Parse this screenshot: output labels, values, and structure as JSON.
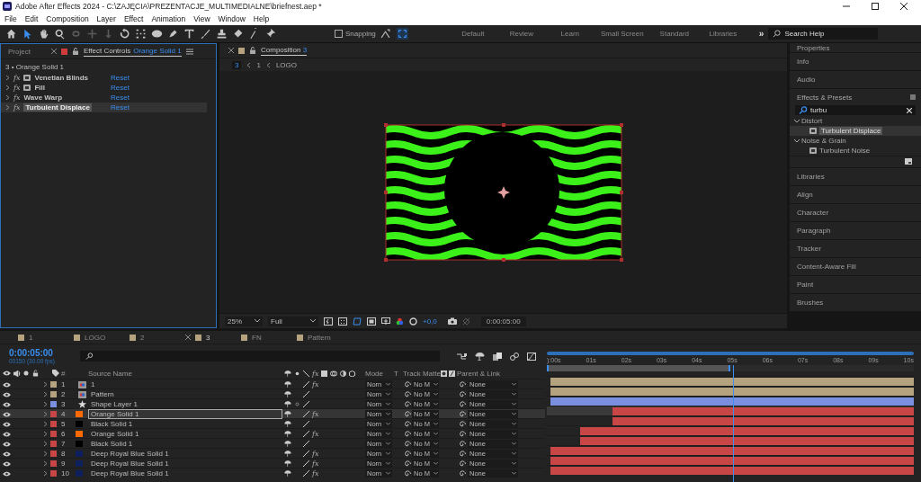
{
  "window": {
    "title": "Adobe After Effects 2024 - C:\\ZAJĘCIA\\PREZENTACJE_MULTIMEDIALNE\\briefnest.aep *"
  },
  "menu": [
    "File",
    "Edit",
    "Composition",
    "Layer",
    "Effect",
    "Animation",
    "View",
    "Window",
    "Help"
  ],
  "tools": [
    {
      "kind": "home",
      "selected": false,
      "disabled": false
    },
    {
      "kind": "select",
      "selected": true,
      "disabled": false
    },
    {
      "kind": "hand",
      "selected": false,
      "disabled": false
    },
    {
      "kind": "zoom",
      "selected": false,
      "disabled": false
    },
    {
      "kind": "orbit",
      "selected": false,
      "disabled": true
    },
    {
      "kind": "move",
      "selected": false,
      "disabled": true
    },
    {
      "kind": "dolly",
      "selected": false,
      "disabled": true
    },
    {
      "kind": "rotate",
      "selected": false,
      "disabled": false
    },
    {
      "kind": "anchor",
      "selected": false,
      "disabled": false
    },
    {
      "kind": "ellipse",
      "selected": false,
      "disabled": false
    },
    {
      "kind": "pen",
      "selected": false,
      "disabled": false
    },
    {
      "kind": "type",
      "selected": false,
      "disabled": false
    },
    {
      "kind": "brush",
      "selected": false,
      "disabled": false
    },
    {
      "kind": "stamp",
      "selected": false,
      "disabled": false
    },
    {
      "kind": "eraser",
      "selected": false,
      "disabled": false
    },
    {
      "kind": "roto",
      "selected": false,
      "disabled": false
    },
    {
      "kind": "pin",
      "selected": false,
      "disabled": false
    }
  ],
  "snapping": {
    "label": "Snapping",
    "checked": false
  },
  "workspaces": [
    "Default",
    "Review",
    "Learn",
    "Small Screen",
    "Standard",
    "Libraries"
  ],
  "more": "»",
  "search_help": {
    "placeholder": "Search Help"
  },
  "effect_controls": {
    "tabs": [
      {
        "label": "Project",
        "selected": false
      },
      {
        "label": "Effect Controls",
        "target": "Orange Solid 1",
        "color": "#d03c3c",
        "selected": true
      }
    ],
    "layer_title": "3 • Orange Solid 1",
    "effects": [
      {
        "fx": "fx",
        "name": "Venetian Blinds",
        "preset": true,
        "reset": "Reset",
        "selected": false
      },
      {
        "fx": "fx",
        "name": "Fill",
        "preset": true,
        "reset": "Reset",
        "selected": false
      },
      {
        "fx": "fx",
        "name": "Wave Warp",
        "preset": false,
        "reset": "Reset",
        "selected": false
      },
      {
        "fx": "fx",
        "name": "Turbulent Displace",
        "preset": false,
        "reset": "Reset",
        "selected": true
      }
    ]
  },
  "composition": {
    "tab": {
      "label": "Composition",
      "target": "3",
      "color": "#b5a27f"
    },
    "breadcrumb": [
      "3",
      "1",
      "LOGO"
    ],
    "zoom": "25%",
    "resolution": "Full",
    "exposure": "+0,0",
    "timecode": "0:00:05:00"
  },
  "panels_above": [
    "Properties",
    "Info",
    "Audio"
  ],
  "effects_presets": {
    "title": "Effects & Presets",
    "search": "turbu",
    "tree": [
      {
        "label": "Distort",
        "expanded": true,
        "children": [
          {
            "label": "Turbulent Displace",
            "selected": true
          }
        ]
      },
      {
        "label": "Noise & Grain",
        "expanded": true,
        "children": [
          {
            "label": "Turbulent Noise",
            "selected": false
          }
        ]
      }
    ]
  },
  "panels_below": [
    "Libraries",
    "Align",
    "Character",
    "Paragraph",
    "Tracker",
    "Content-Aware Fill",
    "Paint",
    "Brushes"
  ],
  "timeline": {
    "tabs": [
      {
        "label": "1",
        "selected": false
      },
      {
        "label": "LOGO",
        "selected": false
      },
      {
        "label": "2",
        "selected": false
      },
      {
        "label": "3",
        "selected": true
      },
      {
        "label": "FN",
        "selected": false
      },
      {
        "label": "Pattern",
        "selected": false
      }
    ],
    "current_time": "0:00:05:00",
    "frame_info": "00150 (30.00 fps)",
    "columns": {
      "number": "#",
      "source_name": "Source Name",
      "fx": "fx",
      "mode": "Mode",
      "t": "T",
      "track_matte": "Track Matte",
      "parent": "Parent & Link"
    },
    "ruler": [
      "):00s",
      "01s",
      "02s",
      "03s",
      "04s",
      "05s",
      "06s",
      "07s",
      "08s",
      "09s",
      "10s"
    ],
    "playhead": {
      "level": 0.5
    },
    "layers": [
      {
        "number": "1",
        "name": "1",
        "selected": false,
        "label": {
          "color": "#b5a27f"
        },
        "source": {
          "kind": "comp"
        },
        "fx": "fx",
        "mode": "Norn",
        "track_matte": "No M",
        "parent": "None",
        "level": 0.99
      },
      {
        "number": "2",
        "name": "Pattern",
        "selected": false,
        "label": {
          "color": "#b5a27f"
        },
        "source": {
          "kind": "comp"
        },
        "mode": "Norn",
        "track_matte": "No M",
        "parent": "None",
        "level": 0.99
      },
      {
        "number": "3",
        "name": "Shape Layer 1",
        "selected": false,
        "label": {
          "color": "#7b8fe0"
        },
        "source": {
          "kind": "shape"
        },
        "mode": "Norn",
        "track_matte": "No M",
        "parent": "None",
        "level": 0.99
      },
      {
        "number": "4",
        "name": "Orange Solid 1",
        "selected": true,
        "label": {
          "color": "#c84646"
        },
        "source": {
          "kind": "solid",
          "color": "#ff6a00"
        },
        "fx": "fx",
        "mode": "Norn",
        "track_matte": "No M",
        "parent": "None",
        "level": 0.82
      },
      {
        "number": "5",
        "name": "Black Solid 1",
        "selected": false,
        "label": {
          "color": "#c84646"
        },
        "source": {
          "kind": "solid",
          "color": "#000000"
        },
        "mode": "Norn",
        "track_matte": "No M",
        "parent": "None",
        "level": 0.82
      },
      {
        "number": "6",
        "name": "Orange Solid 1",
        "selected": false,
        "label": {
          "color": "#c84646"
        },
        "source": {
          "kind": "solid",
          "color": "#ff6a00"
        },
        "fx": "fx",
        "mode": "Norn",
        "track_matte": "No M",
        "parent": "None",
        "level": 0.91
      },
      {
        "number": "7",
        "name": "Black Solid 1",
        "selected": false,
        "label": {
          "color": "#c84646"
        },
        "source": {
          "kind": "solid",
          "color": "#000000"
        },
        "mode": "Norn",
        "track_matte": "No M",
        "parent": "None",
        "level": 0.91
      },
      {
        "number": "8",
        "name": "Deep Royal Blue Solid 1",
        "selected": false,
        "label": {
          "color": "#c84646"
        },
        "source": {
          "kind": "solid",
          "color": "#0d1f5c"
        },
        "fx": "fx",
        "mode": "Norn",
        "track_matte": "No M",
        "parent": "None",
        "level": 0.99
      },
      {
        "number": "9",
        "name": "Deep Royal Blue Solid 1",
        "selected": false,
        "label": {
          "color": "#c84646"
        },
        "source": {
          "kind": "solid",
          "color": "#0d1f5c"
        },
        "fx": "fx",
        "mode": "Norn",
        "track_matte": "No M",
        "parent": "None",
        "level": 0.99
      },
      {
        "number": "10",
        "name": "Deep Royal Blue Solid 1",
        "selected": false,
        "label": {
          "color": "#c84646"
        },
        "source": {
          "kind": "solid",
          "color": "#0d1f5c"
        },
        "fx": "fx",
        "mode": "Norn",
        "track_matte": "No M",
        "parent": "None",
        "level": 0.99
      }
    ]
  }
}
